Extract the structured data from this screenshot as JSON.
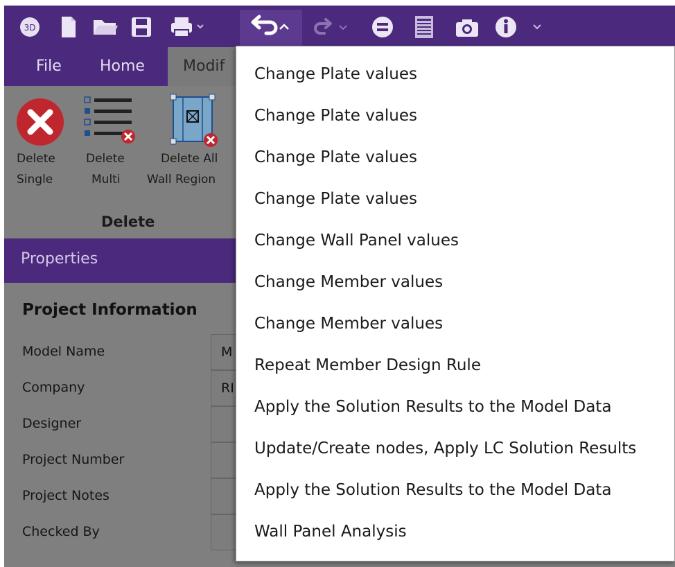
{
  "toolbar": {
    "icons": [
      "3d-view-icon",
      "new-file-icon",
      "open-folder-icon",
      "save-icon",
      "print-icon",
      "undo-icon",
      "redo-icon",
      "equals-icon",
      "report-icon",
      "camera-icon",
      "info-icon"
    ],
    "three_d_label": "3D"
  },
  "tabs": {
    "file": "File",
    "home": "Home",
    "modify": "Modif"
  },
  "ribbon": {
    "delete_single_line1": "Delete",
    "delete_single_line2": "Single",
    "delete_multi_line1": "Delete",
    "delete_multi_line2": "Multi",
    "delete_all_line1": "Delete All",
    "delete_all_line2": "Wall Region",
    "group_label": "Delete"
  },
  "properties": {
    "title": "Properties",
    "section": "Project Information",
    "rows": [
      {
        "label": "Model Name",
        "value": "M"
      },
      {
        "label": "Company",
        "value": "RI"
      },
      {
        "label": "Designer",
        "value": ""
      },
      {
        "label": "Project Number",
        "value": ""
      },
      {
        "label": "Project Notes",
        "value": ""
      },
      {
        "label": "Checked By",
        "value": ""
      }
    ]
  },
  "undo_menu": {
    "items": [
      "Change Plate values",
      "Change Plate values",
      "Change Plate values",
      "Change Plate values",
      "Change Wall Panel values",
      "Change Member values",
      "Change Member values",
      "Repeat Member Design Rule",
      "Apply the Solution Results to the Model Data",
      "Update/Create nodes, Apply LC Solution Results",
      "Apply the Solution Results to the Model Data",
      "Wall Panel Analysis"
    ]
  },
  "colors": {
    "brand_purple": "#4b2a7d",
    "delete_red": "#c0262d",
    "ribbon_gray": "#7f7f7f"
  }
}
